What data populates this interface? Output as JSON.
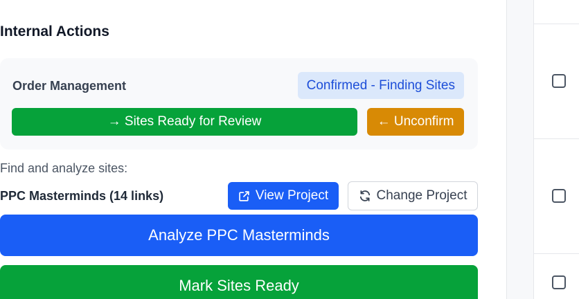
{
  "section": {
    "title": "Internal Actions"
  },
  "order_management": {
    "title": "Order Management",
    "status": "Confirmed - Finding Sites",
    "ready_button": "→ Sites Ready for Review",
    "unconfirm_button": "← Unconfirm"
  },
  "find_sites": {
    "label": "Find and analyze sites:",
    "project_name": "PPC Masterminds (14 links)",
    "view_project_button": "View Project",
    "change_project_button": "Change Project",
    "analyze_button": "Analyze PPC Masterminds",
    "mark_ready_button": "Mark Sites Ready"
  },
  "colors": {
    "primary_blue": "#1a5ef6",
    "success_green": "#06a23a",
    "warning_orange": "#d88a05",
    "badge_bg": "#dbe8fb",
    "badge_text": "#1d4ed8"
  },
  "icons": {
    "view_project": "external-link-icon",
    "change_project": "refresh-icon"
  }
}
